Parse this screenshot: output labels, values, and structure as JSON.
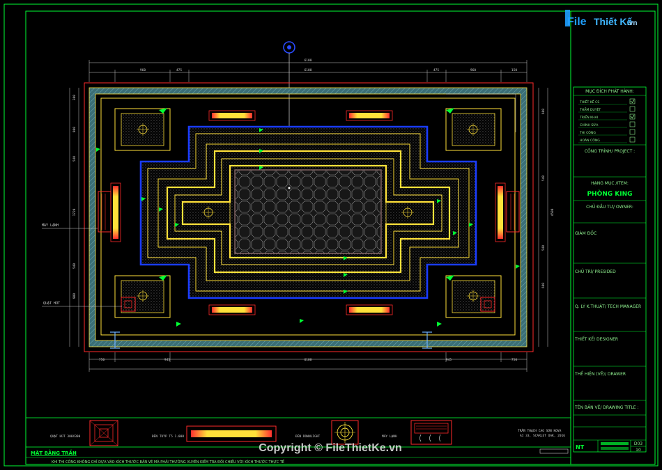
{
  "logo": {
    "brand": "File",
    "brand2": "Thiết Kế",
    "suffix": ".vn"
  },
  "watermark": "Copyright © FileThietKe.vn",
  "title_block": {
    "purpose_header": "MỤC ĐÍCH PHÁT HÀNH:",
    "purpose_items": [
      {
        "label": "THIẾT KẾ CS",
        "checked": true
      },
      {
        "label": "THẨM DUYỆT",
        "checked": false
      },
      {
        "label": "TRIỂN KHAI",
        "checked": true
      },
      {
        "label": "CHỈNH SỬA",
        "checked": false
      },
      {
        "label": "THI CÔNG",
        "checked": false
      },
      {
        "label": "HOÀN CÔNG",
        "checked": false
      }
    ],
    "project_label": "CÔNG TRÌNH/ PROJECT :",
    "item_label": "HẠNG MỤC /ITEM:",
    "item_value": "PHÒNG KING",
    "owner_label": "CHỦ ĐẦU TƯ/ OWNER:",
    "director_label": "GIÁM ĐỐC",
    "presided_label": "CHỦ TRÌ/ PRESIDED",
    "tech_label": "Q. LÝ K.THUẬT/ TECH MANAGER",
    "designer_label": "THIẾT KẾ/ DESIGNER",
    "drawer_label": "THỂ HIỆN (VẼ)/ DRAWER",
    "title_label": "TÊN BẢN VẼ/ DRAWING TITLE :",
    "code": "NT",
    "sheet_no": "D03",
    "sheet_total": "10"
  },
  "drawing": {
    "plan_title": "MẶT BẰNG TRẦN",
    "note": "KHI THI CÔNG KHÔNG CHỈ DỰA VÀO KÍCH THƯỚC BẢN VẼ MÀ PHẢI THƯỜNG XUYÊN KIỂM TRA ĐỐI CHIẾU VỚI KÍCH THƯỚC THỰC TẾ",
    "label_ac": "MÁY LẠNH",
    "label_fan": "QUẠT HÚT",
    "top_dims": [
      "960",
      "475",
      "6100",
      "475",
      "960",
      "150"
    ],
    "overall_top": "6100",
    "bottom_dims": [
      "750",
      "945",
      "6100",
      "945",
      "750"
    ],
    "left_dims": [
      "300",
      "900",
      "540",
      "1720",
      "540",
      "900"
    ],
    "right_dims": [
      "600",
      "540",
      "4500",
      "540",
      "600"
    ]
  },
  "legend": {
    "items": [
      {
        "label": "QUẠT HÚT 300X300"
      },
      {
        "label": "ĐÈN TUÝP T5 1.000"
      },
      {
        "label": "ĐÈN DOWNLIGHT"
      },
      {
        "label": "MÁY LẠNH"
      }
    ],
    "material_line1": "TRẦN THẠCH CAO SƠN KOVA",
    "material_line2": "AI 33, SCARLET OAK, 2016"
  },
  "colors": {
    "frame": "#00ff33",
    "yellow": "#ffe13a",
    "blue": "#1a3cff",
    "red": "#ff2a2a",
    "text": "#8ff08f"
  }
}
